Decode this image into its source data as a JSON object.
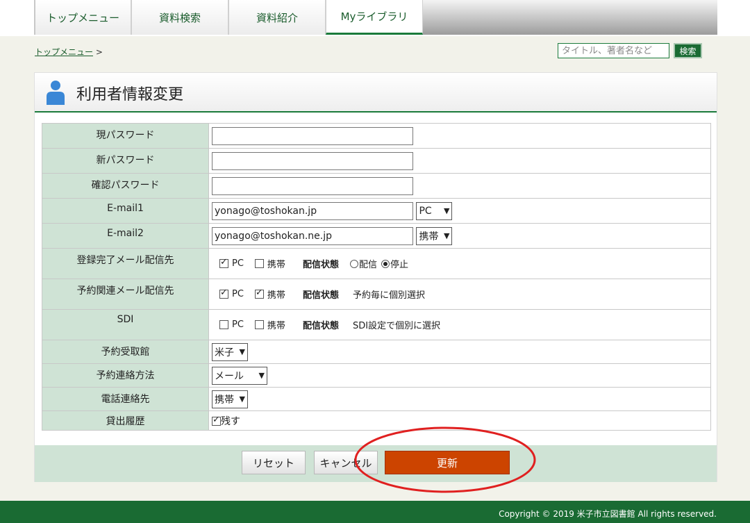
{
  "tabs": [
    {
      "label": "トップメニュー"
    },
    {
      "label": "資料検索"
    },
    {
      "label": "資料紹介"
    },
    {
      "label": "Myライブラリ"
    }
  ],
  "breadcrumb": {
    "link": "トップメニュー",
    "sep": ">"
  },
  "search": {
    "placeholder": "タイトル、著者名など",
    "button": "検索"
  },
  "page_title": "利用者情報変更",
  "form": {
    "current_password": {
      "label": "現パスワード",
      "value": ""
    },
    "new_password": {
      "label": "新パスワード",
      "value": ""
    },
    "confirm_password": {
      "label": "確認パスワード",
      "value": ""
    },
    "email1": {
      "label": "E-mail1",
      "value": "yonago@toshokan.jp",
      "type": "PC"
    },
    "email2": {
      "label": "E-mail2",
      "value": "yonago@toshokan.ne.jp",
      "type": "携帯"
    },
    "reg_mail": {
      "label": "登録完了メール配信先",
      "pc": "PC",
      "pc_checked": true,
      "mobile": "携帯",
      "mobile_checked": false,
      "status_label": "配信状態",
      "opt_deliver": "配信",
      "opt_stop": "停止",
      "selected": "停止"
    },
    "reserve_mail": {
      "label": "予約関連メール配信先",
      "pc": "PC",
      "pc_checked": true,
      "mobile": "携帯",
      "mobile_checked": true,
      "status_label": "配信状態",
      "status_text": "予約毎に個別選択"
    },
    "sdi": {
      "label": "SDI",
      "pc": "PC",
      "pc_checked": false,
      "mobile": "携帯",
      "mobile_checked": false,
      "status_label": "配信状態",
      "status_text": "SDI設定で個別に選択"
    },
    "pickup": {
      "label": "予約受取館",
      "value": "米子"
    },
    "contact_method": {
      "label": "予約連絡方法",
      "value": "メール"
    },
    "phone_contact": {
      "label": "電話連絡先",
      "value": "携帯"
    },
    "history": {
      "label": "貸出履歴",
      "checkbox_label": "残す",
      "checked": true
    }
  },
  "buttons": {
    "reset": "リセット",
    "cancel": "キャンセル",
    "update": "更新"
  },
  "footer": {
    "copyright": "Copyright © 2019 米子市立図書館 All rights reserved."
  },
  "colors": {
    "brand_green": "#1a6b33",
    "label_bg": "#cfe3d5",
    "update_button": "#cc4400",
    "annotation": "#e02020"
  }
}
